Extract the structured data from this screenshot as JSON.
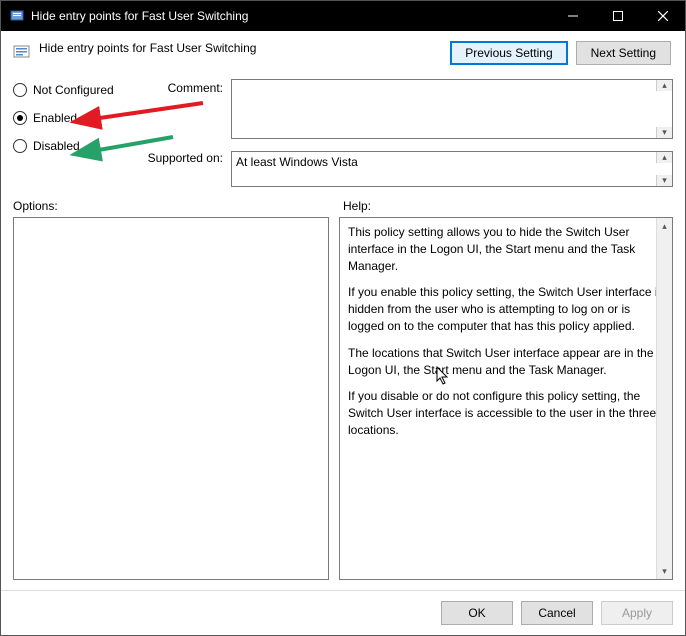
{
  "window": {
    "title": "Hide entry points for Fast User Switching"
  },
  "header": {
    "policy_title": "Hide entry points for Fast User Switching",
    "prev_btn": "Previous Setting",
    "next_btn": "Next Setting"
  },
  "radios": {
    "not_configured": "Not Configured",
    "enabled": "Enabled",
    "disabled": "Disabled"
  },
  "fields": {
    "comment_label": "Comment:",
    "comment_value": "",
    "supported_label": "Supported on:",
    "supported_value": "At least Windows Vista"
  },
  "panes": {
    "options_label": "Options:",
    "help_label": "Help:",
    "help_paragraphs": [
      "This policy setting allows you to hide the Switch User interface in the Logon UI, the Start menu and the Task Manager.",
      "If you enable this policy setting, the Switch User interface is hidden from the user who is attempting to log on or is logged on to the computer that has this policy applied.",
      "The locations that Switch User interface appear are in the Logon UI, the Start menu and the Task Manager.",
      "If you disable or do not configure this policy setting, the Switch User interface is accessible to the user in the three locations."
    ]
  },
  "footer": {
    "ok": "OK",
    "cancel": "Cancel",
    "apply": "Apply"
  }
}
